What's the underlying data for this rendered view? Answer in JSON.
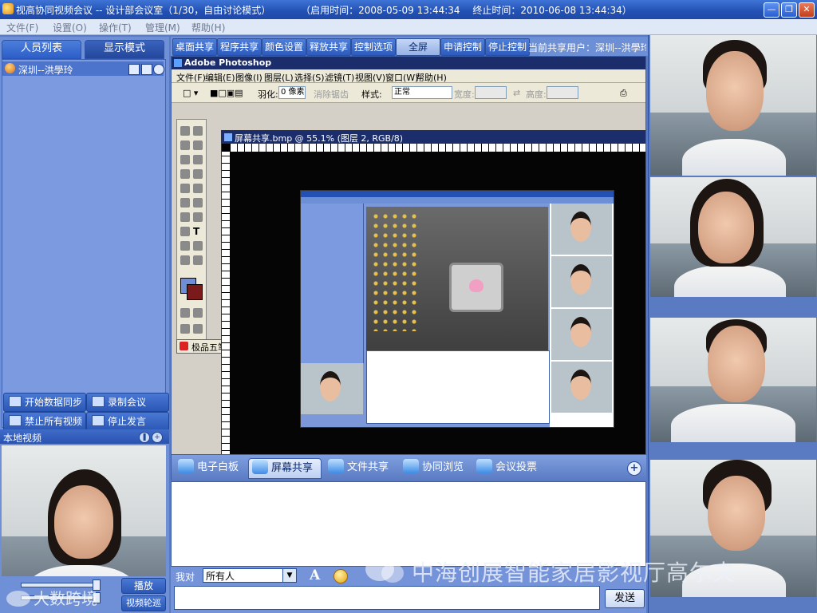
{
  "window": {
    "title": "视高协同视频会议 -- 设计部会议室（1/30，自由讨论模式）",
    "start_time": "（启用时间：2008-05-09 13:44:34",
    "end_time": "终止时间：2010-06-08 13:44:34）"
  },
  "menubar": {
    "items": [
      "文件(F)",
      "设置(O)",
      "操作(T)",
      "管理(M)",
      "帮助(H)"
    ]
  },
  "left_panel": {
    "tabs": [
      "人员列表",
      "显示模式"
    ],
    "users": [
      {
        "name": "深圳--洪學玲"
      }
    ],
    "buttons": [
      "开始数据同步",
      "录制会议",
      "禁止所有视频",
      "停止发言"
    ],
    "local_video_label": "本地视频",
    "play_button": "播放",
    "video_poll_button": "视频轮巡"
  },
  "toolbar": {
    "buttons": [
      "桌面共享",
      "程序共享",
      "颜色设置",
      "释放共享",
      "控制选项",
      "全屏",
      "申请控制",
      "停止控制"
    ],
    "current_share_user": "当前共享用户：深圳--洪學玲"
  },
  "shared_screen": {
    "app_title": "Adobe Photoshop",
    "menu": [
      "文件(F)",
      "编辑(E)",
      "图像(I)",
      "图层(L)",
      "选择(S)",
      "滤镜(T)",
      "视图(V)",
      "窗口(W)",
      "帮助(H)"
    ],
    "options": {
      "feather_label": "羽化:",
      "feather_value": "0 像素",
      "antialias_label": "消除锯齿",
      "style_label": "样式:",
      "style_value": "正常",
      "width_label": "宽度:",
      "height_label": "高度:"
    },
    "ime_label": "极品五笔",
    "doc_title": "屏幕共享.bmp @ 55.1% (图层 2, RGB/8)"
  },
  "feature_tabs": {
    "items": [
      "电子白板",
      "屏幕共享",
      "文件共享",
      "协同浏览",
      "会议投票"
    ],
    "active": "屏幕共享"
  },
  "chat": {
    "to_label": "我对",
    "recipient": "所有人",
    "send_button": "发送"
  },
  "watermarks": {
    "brand": "中海创展智能家居影视厅高尔夫",
    "left": "大数跨境"
  },
  "colors": {
    "title_bar": "#2350b3",
    "panel": "#6f8fd6",
    "accent": "#4e7ed9"
  }
}
